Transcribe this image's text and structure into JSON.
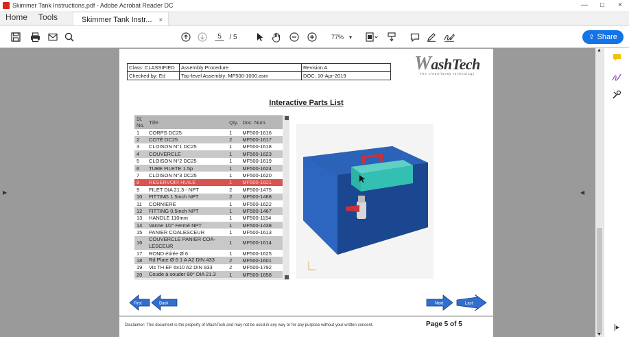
{
  "window": {
    "title": "Skimmer Tank Instructions.pdf - Adobe Acrobat Reader DC",
    "controls": [
      "—",
      "□",
      "×"
    ]
  },
  "menubar": {
    "home": "Home",
    "tools": "Tools",
    "doc_tab": "Skimmer Tank Instr...",
    "doc_tab_close": "×"
  },
  "toolbar": {
    "page_current": "5",
    "page_total": "/ 5",
    "zoom": "77%",
    "share_label": "Share"
  },
  "document": {
    "header": {
      "class": "Class: CLASSIFIED",
      "procedure": "Assembly Procedure",
      "revision": "Revision A",
      "checked": "Checked by: Ed",
      "assembly": "Top-level Assembly: MF500-1000.asm",
      "doc_date": "DOC: 10-Apr-2019"
    },
    "logo": {
      "brand_w": "W",
      "brand_rest": "ashTech",
      "tagline": "The cleanliness technology"
    },
    "heading": "Interactive Parts List",
    "parts_columns": [
      "Sl. No.",
      "Title",
      "Qty.",
      "Doc. Num."
    ],
    "parts": [
      {
        "no": "1",
        "title": "CORPS DC25",
        "qty": "1",
        "doc": "MF500-1616"
      },
      {
        "no": "2",
        "title": "COTÉ DC25",
        "qty": "2",
        "doc": "MF500-1617"
      },
      {
        "no": "3",
        "title": "CLOISON N°1 DC25",
        "qty": "1",
        "doc": "MF500-1618"
      },
      {
        "no": "4",
        "title": "COUVERCLE",
        "qty": "1",
        "doc": "MF500-1623"
      },
      {
        "no": "5",
        "title": "CLOISON N°2 DC25",
        "qty": "1",
        "doc": "MF500-1619"
      },
      {
        "no": "6",
        "title": "TUBE FILETE 1.5p",
        "qty": "1",
        "doc": "MF500-1624"
      },
      {
        "no": "7",
        "title": "CLOISON N°3 DC25",
        "qty": "1",
        "doc": "MF500-1620"
      },
      {
        "no": "8",
        "title": "RESERVOIR HUILE",
        "qty": "1",
        "doc": "MF500-1621"
      },
      {
        "no": "9",
        "title": "FILET DIA 21.3 - NPT",
        "qty": "2",
        "doc": "MF500-1475"
      },
      {
        "no": "10",
        "title": "FITTING 1.5inch NPT",
        "qty": "2",
        "doc": "MF500-1468"
      },
      {
        "no": "11",
        "title": "CORNIERE",
        "qty": "1",
        "doc": "MF500-1622"
      },
      {
        "no": "12",
        "title": "FITTING 0.5inch NPT",
        "qty": "1",
        "doc": "MF500-1467"
      },
      {
        "no": "13",
        "title": "HANDLE 110mm",
        "qty": "1",
        "doc": "MF500-1154"
      },
      {
        "no": "14",
        "title": "Vanne 1/2\" Fermé NPT",
        "qty": "1",
        "doc": "MF500-1438"
      },
      {
        "no": "15",
        "title": "PANIER COALESCEUR",
        "qty": "1",
        "doc": "MF500-1613"
      },
      {
        "no": "16",
        "title": "COUVERCLE PANIER COA-LESCEUR",
        "qty": "1",
        "doc": "MF500-1614"
      },
      {
        "no": "17",
        "title": "ROND étirée Ø 6",
        "qty": "1",
        "doc": "MF500-1625"
      },
      {
        "no": "18",
        "title": "Rd Plate Ø 6 1 A  A2 DIN 433",
        "qty": "2",
        "doc": "MF500-1601"
      },
      {
        "no": "19",
        "title": "Vis TH EF 6x10 A2  DIN 933",
        "qty": "2",
        "doc": "MF500-1792"
      },
      {
        "no": "20",
        "title": "Coude à souder 90° DIA 21.3",
        "qty": "1",
        "doc": "MF500-1658"
      }
    ],
    "selected_part": "8",
    "nav": {
      "first": "First",
      "back": "Back",
      "next": "Next",
      "last": "Last"
    },
    "disclaimer": "Disclaimer: This document is the property of WashTech and may not be used in any way or for any purpose without your written consent.",
    "page_label": "Page 5 of 5"
  },
  "colors": {
    "accent": "#1473e6",
    "selected_row": "#d9534f",
    "tank_blue": "#1d4f9c",
    "tank_teal": "#2bb3a6",
    "handle_red": "#c8323c",
    "nav_blue": "#2f6fd0"
  }
}
